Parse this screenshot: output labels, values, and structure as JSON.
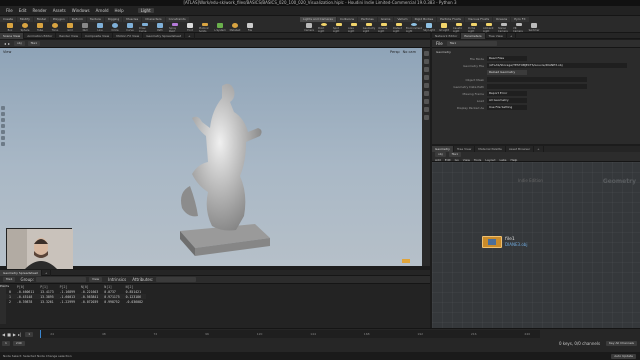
{
  "window": {
    "title": "[ATLAS]Work/edu-sk/work_files/BASICS/BASICS_020_100_020_Visualization.hiplc - Houdini Indie Limited-Commercial 19.0.383 - Python 3"
  },
  "menu": [
    "File",
    "Edit",
    "Render",
    "Assets",
    "Windows",
    "Arnold",
    "Help"
  ],
  "desktop": "Light",
  "shelf": {
    "tabs": [
      "Create",
      "Modify",
      "Model",
      "Polygon",
      "Deform",
      "Texture",
      "Rigging",
      "Muscles",
      "Characters",
      "Constraints",
      "Guide Process",
      "Terrain FX",
      "Simple FX",
      "Volume",
      "+"
    ],
    "tools": [
      "Box",
      "Sphere",
      "Tube",
      "Torus",
      "Grid",
      "Null",
      "Line",
      "Circle",
      "Curve",
      "Draw Curve",
      "Path",
      "Spray Paint",
      "Font",
      "Platonic Solids",
      "L-System",
      "Metaball",
      "File"
    ],
    "light_tabs": [
      "Lights and Cameras",
      "Collisions",
      "Particles",
      "Grains",
      "Vellum",
      "Rigid Bodies",
      "Particle Fluids",
      "Viscous Fluids",
      "Oceans",
      "Pyro FX",
      "FEM",
      "Wires",
      "Crowds",
      "Drive Simulation"
    ],
    "light_tools": [
      "Camera",
      "Point Light",
      "Spot Light",
      "Area Light",
      "Geometry Light",
      "Volume Light",
      "Distant Light",
      "Environment Light",
      "Sky Light",
      "GI Light",
      "Caustic Light",
      "Portal Light",
      "Ambient Light",
      "Stereo Camera",
      "VR Camera",
      "Switcher"
    ]
  },
  "viewer": {
    "tabs": [
      "Scene View",
      "Animation Editor",
      "Render View",
      "Composite View",
      "Motion FX View",
      "Geometry Spreadsheet",
      "+"
    ],
    "path": [
      "obj",
      "file1"
    ],
    "view_label": "View",
    "persp": "Persp",
    "cam": "No cam"
  },
  "spreadsheet": {
    "tabs": [
      "Geometry Spreadsheet",
      "+"
    ],
    "node": "file1",
    "group_label": "Group:",
    "view_label": "View",
    "intrinsics": "Intrinsics",
    "attributes": "Attributes:",
    "mode": "Points",
    "columns": [
      "",
      "P[0]",
      "P[1]",
      "P[2]",
      "N[0]",
      "N[1]",
      "N[2]"
    ],
    "rows": [
      [
        "0",
        "-0.460611",
        "13.4173",
        "-1.16899",
        "-0.221603",
        "0.0737",
        "0.851421"
      ],
      [
        "1",
        "-0.45148",
        "13.3895",
        "-1.60013",
        "-0.563841",
        "0.971175",
        "0.123186"
      ],
      [
        "2",
        "-0.39878",
        "13.3261",
        "-1.22999",
        "-0.072039",
        "0.998752",
        "-0.036082"
      ]
    ]
  },
  "parameters": {
    "tabs": [
      "Network Editor",
      "Parameters",
      "Tree View",
      "+"
    ],
    "node_type": "File",
    "node_name": "file1",
    "section": "Geometry",
    "fields": [
      {
        "label": "File Mode",
        "value": "Read Files"
      },
      {
        "label": "Geometry File",
        "value": "/ATLAS/Storage/TESTOBJECTS/Louvre/DIANE3.obj"
      },
      {
        "label": "",
        "value": "Reload Geometry"
      },
      {
        "label": "Object Mask",
        "value": ""
      },
      {
        "label": "Geometry Data Path",
        "value": ""
      },
      {
        "label": "Missing Frame",
        "value": "Report Error"
      },
      {
        "label": "Load",
        "value": "All Geometry"
      },
      {
        "label": "Display Packed As",
        "value": "Use File Setting"
      }
    ]
  },
  "network": {
    "tabs": [
      "Geometry",
      "Tree View",
      "Material Palette",
      "Asset Browser",
      "+"
    ],
    "path": [
      "obj",
      "file1"
    ],
    "menu": [
      "Add",
      "Edit",
      "Go",
      "View",
      "Tools",
      "Layout",
      "Labs",
      "Help"
    ],
    "context_label": "Geometry",
    "indie_label": "Indie Edition",
    "node_name": "file1",
    "node_file": "DIANE3.obj"
  },
  "timeline": {
    "frame": "1",
    "start": "1",
    "end": "240",
    "ticks": [
      "24",
      "48",
      "72",
      "96",
      "120",
      "144",
      "168",
      "192",
      "216",
      "240"
    ],
    "keys_label": "0 keys, 0/0 channels",
    "key_all": "Key All Channels",
    "auto_update": "Auto Update"
  },
  "status": {
    "text": "Node Select: Selected Node Change selection"
  },
  "colors": {
    "accent": "#e8a23a",
    "node_color": "#c98b2a",
    "viewport_top": "#8fa4b8"
  }
}
